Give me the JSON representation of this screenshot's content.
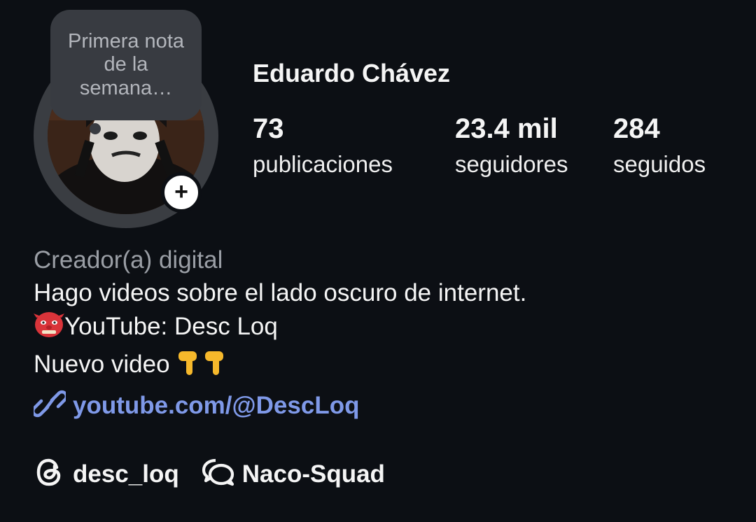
{
  "note": {
    "text": "Primera nota de la semana…"
  },
  "profile": {
    "name": "Eduardo Chávez",
    "stats": {
      "posts_value": "73",
      "posts_label": "publicaciones",
      "followers_value": "23.4 mil",
      "followers_label": "seguidores",
      "following_value": "284",
      "following_label": "seguidos"
    },
    "avatar_icon": "profile-photo",
    "add_icon": "plus-icon"
  },
  "bio": {
    "category": "Creador(a) digital",
    "line1": "Hago videos sobre el lado oscuro de internet.",
    "line2": "YouTube: Desc Loq",
    "line3": "Nuevo video ",
    "link_text": "youtube.com/@DescLoq"
  },
  "chips": {
    "threads_label": "desc_loq",
    "group_label": "Naco-Squad"
  },
  "colors": {
    "background": "#0c0f14",
    "link": "#7f99e8",
    "category": "#9a9ea5",
    "note_bubble": "#383b41"
  }
}
